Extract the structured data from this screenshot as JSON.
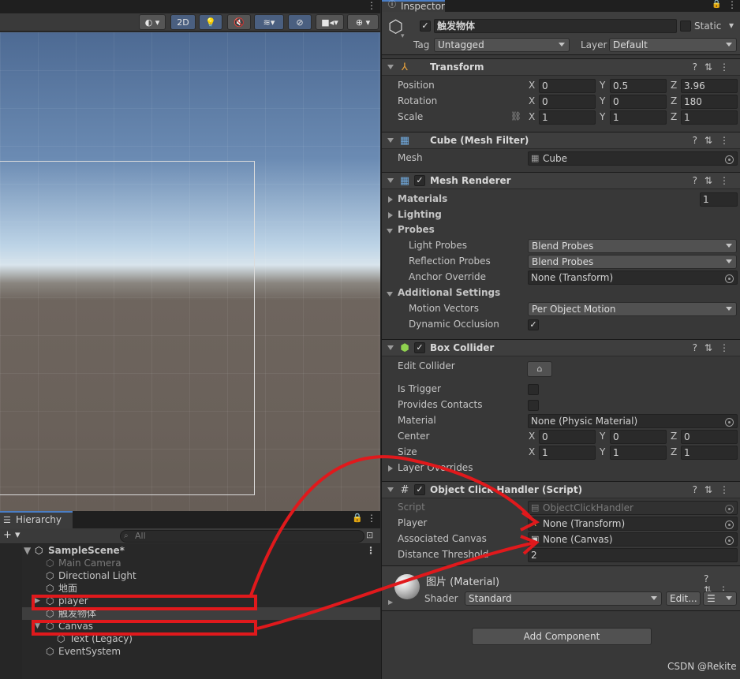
{
  "scene": {
    "toolbar": {
      "mode_2d": "2D"
    },
    "menu_icon": "⋮"
  },
  "hierarchy": {
    "tab": "Hierarchy",
    "lock_icon": "lock-icon",
    "add": "+ ▾",
    "search_placeholder": "All",
    "items": [
      {
        "label": "SampleScene*"
      },
      {
        "label": "Main Camera"
      },
      {
        "label": "Directional Light"
      },
      {
        "label": "地面"
      },
      {
        "label": "player"
      },
      {
        "label": "触发物体"
      },
      {
        "label": "Canvas"
      },
      {
        "label": "Text (Legacy)"
      },
      {
        "label": "EventSystem"
      }
    ]
  },
  "inspector": {
    "tab": "Inspector",
    "object_name": "触发物体",
    "static_label": "Static",
    "tag_label": "Tag",
    "tag_value": "Untagged",
    "layer_label": "Layer",
    "layer_value": "Default",
    "transform": {
      "title": "Transform",
      "position_label": "Position",
      "rotation_label": "Rotation",
      "scale_label": "Scale",
      "x": "X",
      "y": "Y",
      "z": "Z",
      "position": [
        "0",
        "0.5",
        "3.96"
      ],
      "rotation": [
        "0",
        "0",
        "180"
      ],
      "scale": [
        "1",
        "1",
        "1"
      ]
    },
    "mesh_filter": {
      "title": "Cube (Mesh Filter)",
      "mesh_label": "Mesh",
      "mesh_value": "Cube"
    },
    "mesh_renderer": {
      "title": "Mesh Renderer",
      "materials_label": "Materials",
      "materials_count": "1",
      "lighting_label": "Lighting",
      "probes_label": "Probes",
      "light_probes_label": "Light Probes",
      "light_probes_value": "Blend Probes",
      "reflection_probes_label": "Reflection Probes",
      "reflection_probes_value": "Blend Probes",
      "anchor_override_label": "Anchor Override",
      "anchor_override_value": "None (Transform)",
      "additional_label": "Additional Settings",
      "motion_vectors_label": "Motion Vectors",
      "motion_vectors_value": "Per Object Motion",
      "dynamic_occlusion_label": "Dynamic Occlusion"
    },
    "box_collider": {
      "title": "Box Collider",
      "edit_collider_label": "Edit Collider",
      "is_trigger_label": "Is Trigger",
      "provides_contacts_label": "Provides Contacts",
      "material_label": "Material",
      "material_value": "None (Physic Material)",
      "center_label": "Center",
      "center": [
        "0",
        "0",
        "0"
      ],
      "size_label": "Size",
      "size": [
        "1",
        "1",
        "1"
      ],
      "layer_overrides_label": "Layer Overrides"
    },
    "script": {
      "title": "Object Click Handler (Script)",
      "script_label": "Script",
      "script_value": "ObjectClickHandler",
      "player_label": "Player",
      "player_value": "None (Transform)",
      "canvas_label": "Associated Canvas",
      "canvas_value": "None (Canvas)",
      "threshold_label": "Distance Threshold",
      "threshold_value": "2"
    },
    "material": {
      "title": "图片 (Material)",
      "shader_label": "Shader",
      "shader_value": "Standard",
      "edit_label": "Edit..."
    },
    "add_component": "Add Component"
  },
  "watermark": "CSDN @Rekite",
  "colors": {
    "annotation": "#e0191c",
    "selection_tab": "#4a7ec6"
  }
}
